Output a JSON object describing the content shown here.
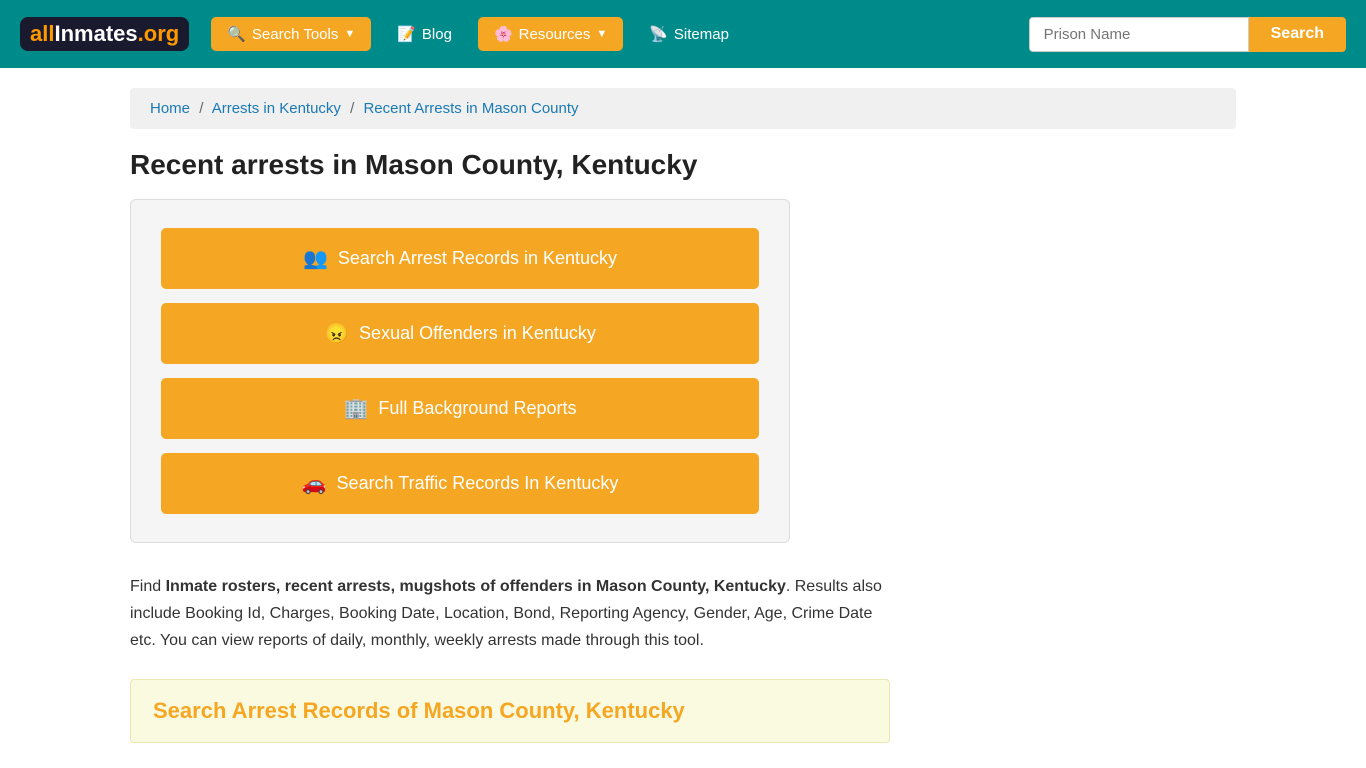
{
  "header": {
    "logo": {
      "part1": "all",
      "part2": "Inmates",
      "part3": ".org"
    },
    "nav": [
      {
        "id": "search-tools",
        "label": "Search Tools",
        "icon": "🔍",
        "hasArrow": true
      },
      {
        "id": "blog",
        "label": "Blog",
        "icon": "📝",
        "hasArrow": false
      },
      {
        "id": "resources",
        "label": "Resources",
        "icon": "🌸",
        "hasArrow": true
      },
      {
        "id": "sitemap",
        "label": "Sitemap",
        "icon": "📡",
        "hasArrow": false
      }
    ],
    "search": {
      "placeholder": "Prison Name",
      "button_label": "Search"
    }
  },
  "breadcrumb": {
    "home": "Home",
    "arrests": "Arrests in Kentucky",
    "current": "Recent Arrests in Mason County"
  },
  "page": {
    "title": "Recent arrests in Mason County, Kentucky",
    "buttons": [
      {
        "id": "search-arrest",
        "icon": "👥",
        "label": "Search Arrest Records in Kentucky"
      },
      {
        "id": "sexual-offenders",
        "icon": "😠",
        "label": "Sexual Offenders in Kentucky"
      },
      {
        "id": "background",
        "icon": "🏢",
        "label": "Full Background Reports"
      },
      {
        "id": "traffic",
        "icon": "🚗",
        "label": "Search Traffic Records In Kentucky"
      }
    ],
    "description_pre": "Find ",
    "description_bold": "Inmate rosters, recent arrests, mugshots of offenders in Mason County, Kentucky",
    "description_post": ". Results also include Booking Id, Charges, Booking Date, Location, Bond, Reporting Agency, Gender, Age, Crime Date etc. You can view reports of daily, monthly, weekly arrests made through this tool.",
    "bottom_heading": "Search Arrest Records of Mason County, Kentucky"
  }
}
